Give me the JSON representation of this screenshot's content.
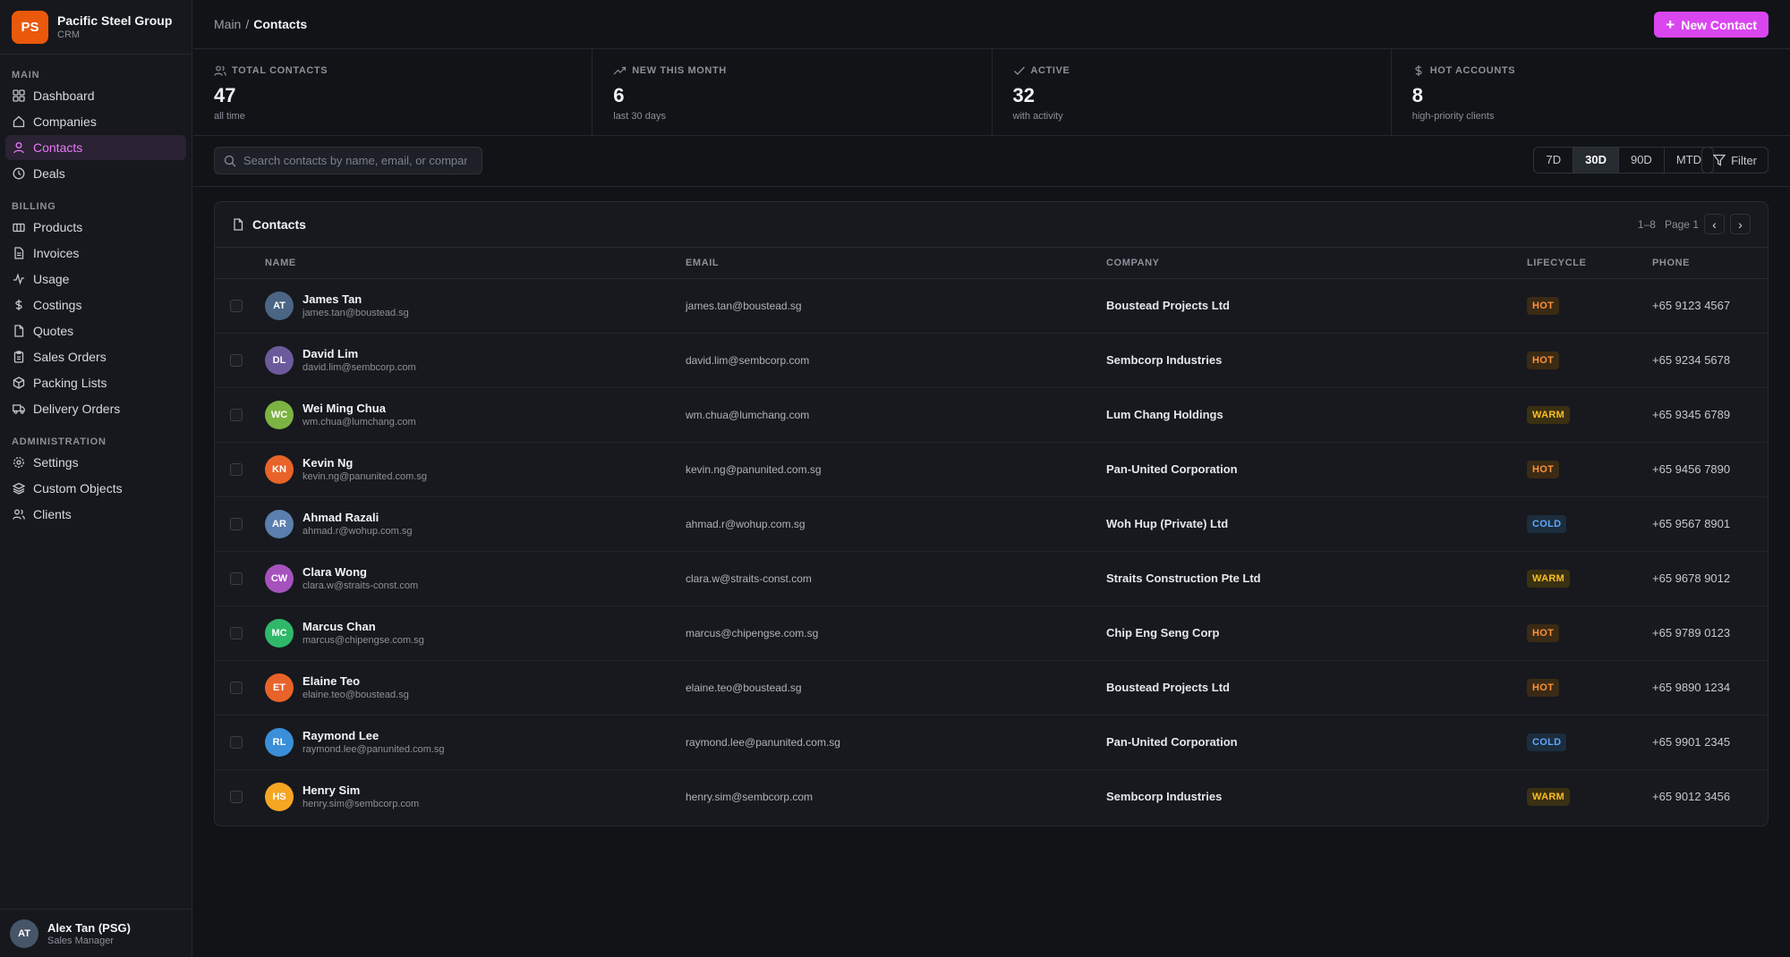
{
  "brand": {
    "logo": "PS",
    "name": "Pacific Steel Group",
    "sub": "CRM",
    "accent": "#ea580c"
  },
  "nav": {
    "main_heading": "MAIN",
    "main": [
      {
        "label": "Dashboard",
        "icon": "grid-icon"
      },
      {
        "label": "Companies",
        "icon": "home-icon"
      },
      {
        "label": "Contacts",
        "icon": "user-icon",
        "active": true
      },
      {
        "label": "Deals",
        "icon": "clock-icon"
      }
    ],
    "billing_heading": "BILLING",
    "billing": [
      {
        "label": "Products",
        "icon": "box-icon"
      },
      {
        "label": "Invoices",
        "icon": "document-icon"
      },
      {
        "label": "Usage",
        "icon": "activity-icon"
      },
      {
        "label": "Costings",
        "icon": "dollar-icon"
      },
      {
        "label": "Quotes",
        "icon": "file-icon"
      },
      {
        "label": "Sales Orders",
        "icon": "clipboard-icon"
      },
      {
        "label": "Packing Lists",
        "icon": "package-icon"
      },
      {
        "label": "Delivery Orders",
        "icon": "truck-icon"
      }
    ],
    "admin_heading": "ADMINISTRATION",
    "admin": [
      {
        "label": "Settings",
        "icon": "gear-icon"
      },
      {
        "label": "Custom Objects",
        "icon": "layers-icon"
      },
      {
        "label": "Clients",
        "icon": "users-icon"
      }
    ]
  },
  "user": {
    "initials": "AT",
    "name": "Alex Tan (PSG)",
    "role": "Sales Manager"
  },
  "header": {
    "crumb_root": "Main",
    "crumb_sep": "/",
    "crumb_current": "Contacts",
    "new_button": "New Contact",
    "accent": "#d946ef"
  },
  "stats": [
    {
      "label": "TOTAL CONTACTS",
      "value": "47",
      "sub": "all time",
      "icon": "users-icon"
    },
    {
      "label": "NEW THIS MONTH",
      "value": "6",
      "sub": "last 30 days",
      "icon": "trending-up-icon"
    },
    {
      "label": "ACTIVE",
      "value": "32",
      "sub": "with activity",
      "icon": "check-icon"
    },
    {
      "label": "HOT ACCOUNTS",
      "value": "8",
      "sub": "high-priority clients",
      "icon": "dollar-icon"
    }
  ],
  "search": {
    "placeholder": "Search contacts by name, email, or company"
  },
  "ranges": [
    "7D",
    "30D",
    "90D",
    "MTD"
  ],
  "active_range": "30D",
  "filter_label": "Filter",
  "table": {
    "title": "Contacts",
    "range_text": "1–8",
    "page_text": "Page 1",
    "prev": "‹",
    "next": "›",
    "columns": [
      "NAME",
      "EMAIL",
      "COMPANY",
      "LIFECYCLE",
      "PHONE"
    ],
    "rows": [
      {
        "initials": "AT",
        "color": "#4b6584",
        "name": "James Tan",
        "email": "james.tan@boustead.sg",
        "company": "Boustead Projects Ltd",
        "lifecycle": "HOT",
        "phone": "+65 9123 4567"
      },
      {
        "initials": "DL",
        "color": "#6d5a9c",
        "name": "David Lim",
        "email": "david.lim@sembcorp.com",
        "company": "Sembcorp Industries",
        "lifecycle": "HOT",
        "phone": "+65 9234 5678"
      },
      {
        "initials": "WC",
        "color": "#7cb342",
        "name": "Wei Ming Chua",
        "email": "wm.chua@lumchang.com",
        "company": "Lum Chang Holdings",
        "lifecycle": "WARM",
        "phone": "+65 9345 6789"
      },
      {
        "initials": "KN",
        "color": "#e8632a",
        "name": "Kevin Ng",
        "email": "kevin.ng@panunited.com.sg",
        "company": "Pan-United Corporation",
        "lifecycle": "HOT",
        "phone": "+65 9456 7890"
      },
      {
        "initials": "AR",
        "color": "#5b7fae",
        "name": "Ahmad Razali",
        "email": "ahmad.r@wohup.com.sg",
        "company": "Woh Hup (Private) Ltd",
        "lifecycle": "COLD",
        "phone": "+65 9567 8901"
      },
      {
        "initials": "CW",
        "color": "#a652bd",
        "name": "Clara Wong",
        "email": "clara.w@straits-const.com",
        "company": "Straits Construction Pte Ltd",
        "lifecycle": "WARM",
        "phone": "+65 9678 9012"
      },
      {
        "initials": "MC",
        "color": "#2fb86a",
        "name": "Marcus Chan",
        "email": "marcus@chipengse.com.sg",
        "company": "Chip Eng Seng Corp",
        "lifecycle": "HOT",
        "phone": "+65 9789 0123"
      },
      {
        "initials": "ET",
        "color": "#e8632a",
        "name": "Elaine Teo",
        "email": "elaine.teo@boustead.sg",
        "company": "Boustead Projects Ltd",
        "lifecycle": "HOT",
        "phone": "+65 9890 1234"
      },
      {
        "initials": "RL",
        "color": "#3b8fd9",
        "name": "Raymond Lee",
        "email": "raymond.lee@panunited.com.sg",
        "company": "Pan-United Corporation",
        "lifecycle": "COLD",
        "phone": "+65 9901 2345"
      },
      {
        "initials": "HS",
        "color": "#f5a623",
        "name": "Henry Sim",
        "email": "henry.sim@sembcorp.com",
        "company": "Sembcorp Industries",
        "lifecycle": "WARM",
        "phone": "+65 9012 3456"
      }
    ]
  }
}
